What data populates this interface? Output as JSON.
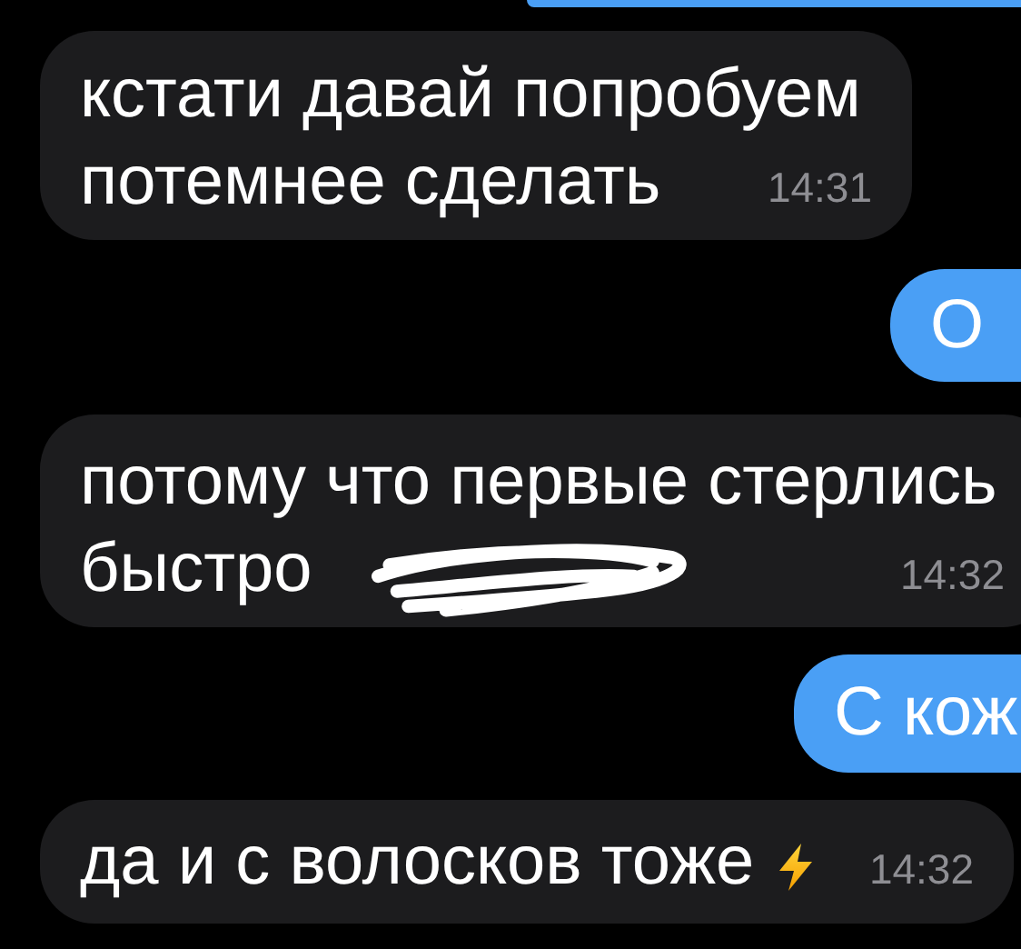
{
  "messages": [
    {
      "kind": "sliver"
    },
    {
      "kind": "incoming",
      "lines": [
        "кстати давай попробуем",
        "потемнее сделать"
      ],
      "time": "14:31"
    },
    {
      "kind": "outgoing",
      "text": "О"
    },
    {
      "kind": "incoming",
      "lines": [
        "потому что первые стерлись",
        "быстро"
      ],
      "time": "14:32",
      "scribbled": true
    },
    {
      "kind": "outgoing",
      "text": "С кож"
    },
    {
      "kind": "incoming",
      "lines": [
        "да и с волосков тоже"
      ],
      "time": "14:32",
      "lightning": true
    }
  ]
}
